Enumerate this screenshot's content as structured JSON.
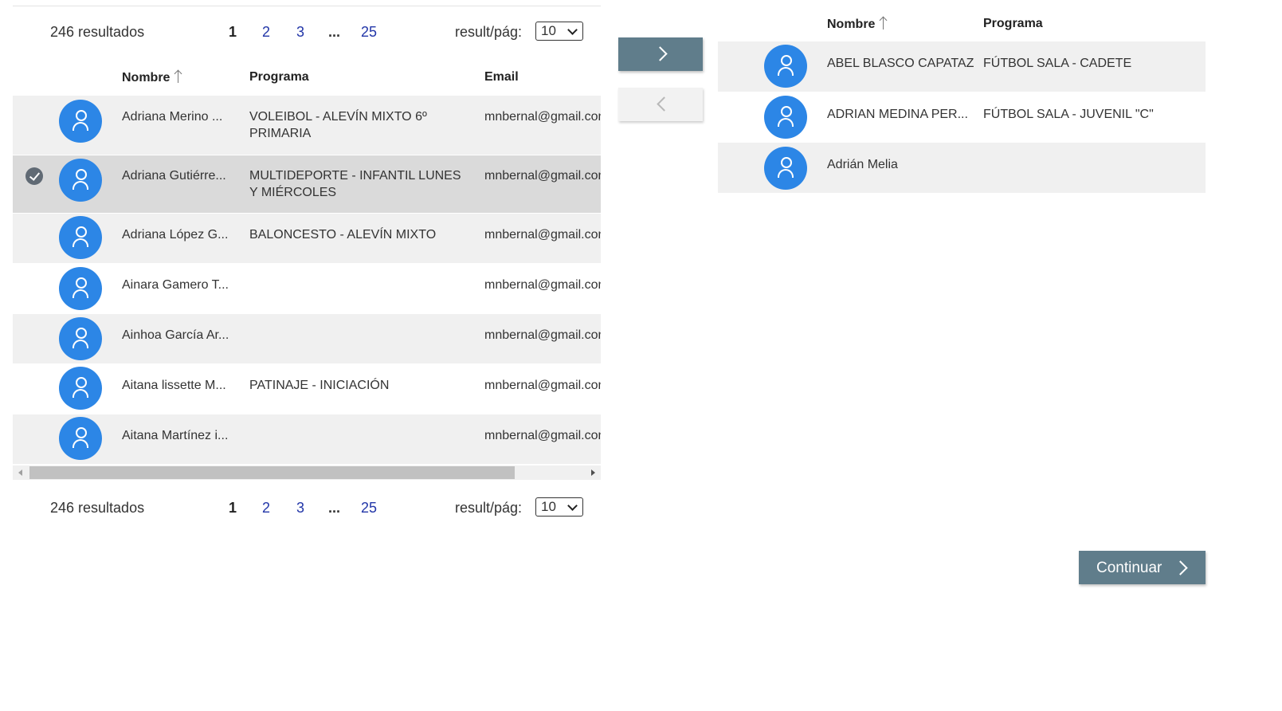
{
  "pagination": {
    "count_label": "246 resultados",
    "pages": [
      "1",
      "2",
      "3",
      "...",
      "25"
    ],
    "current_page": "1",
    "per_page_label": "result/pág:",
    "per_page_value": "10"
  },
  "left_table": {
    "columns": {
      "name": "Nombre",
      "program": "Programa",
      "email": "Email"
    },
    "sort_column": "Nombre",
    "rows": [
      {
        "name": "Adriana Merino ...",
        "program": "VOLEIBOL - ALEVÍN MIXTO 6º PRIMARIA",
        "email": "mnbernal@gmail.com",
        "selected": false
      },
      {
        "name": "Adriana Gutiérre...",
        "program": "MULTIDEPORTE - INFANTIL LUNES Y MIÉRCOLES",
        "email": "mnbernal@gmail.com",
        "selected": true
      },
      {
        "name": "Adriana López G...",
        "program": "BALONCESTO - ALEVÍN MIXTO",
        "email": "mnbernal@gmail.com",
        "selected": false
      },
      {
        "name": "Ainara Gamero T...",
        "program": "",
        "email": "mnbernal@gmail.com",
        "selected": false
      },
      {
        "name": "Ainhoa García Ar...",
        "program": "",
        "email": "mnbernal@gmail.com",
        "selected": false
      },
      {
        "name": "Aitana lissette M...",
        "program": "PATINAJE - INICIACIÓN",
        "email": "mnbernal@gmail.com",
        "selected": false
      },
      {
        "name": "Aitana Martínez i...",
        "program": "",
        "email": "mnbernal@gmail.com",
        "selected": false
      }
    ]
  },
  "transfer": {
    "add_icon": "chevron-right-icon",
    "remove_icon": "chevron-left-icon"
  },
  "right_table": {
    "columns": {
      "name": "Nombre",
      "program": "Programa"
    },
    "rows": [
      {
        "name": "ABEL BLASCO CAPATAZ",
        "program": "FÚTBOL SALA - CADETE"
      },
      {
        "name": "ADRIAN MEDINA PER...",
        "program": "FÚTBOL SALA - JUVENIL \"C\""
      },
      {
        "name": "Adrián Melia",
        "program": ""
      }
    ]
  },
  "actions": {
    "continue_label": "Continuar"
  },
  "colors": {
    "accent": "#607d8b",
    "avatar": "#2c86e6",
    "link": "#2236a8",
    "row_alt": "#f0f0f0",
    "row_selected": "#dadada"
  }
}
